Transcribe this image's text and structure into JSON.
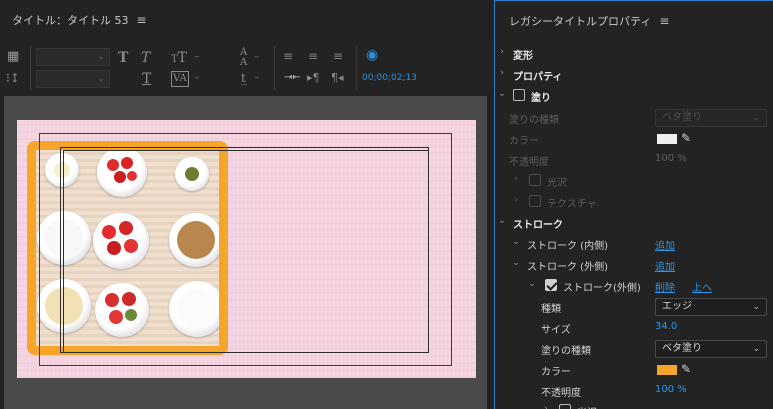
{
  "title_panel": {
    "title": "タイトル：タイトル 53",
    "menu_icon": "hamburger-menu-icon",
    "timecode": "00;00;02;13"
  },
  "props_panel": {
    "title": "レガシータイトルプロパティ",
    "menu_icon": "hamburger-menu-icon",
    "sections": {
      "transform": "変形",
      "properties": "プロパティ",
      "fill": "塗り",
      "fill_type_label": "塗りの種類",
      "fill_type_value": "ベタ塗り",
      "color_label": "カラー",
      "opacity_label": "不透明度",
      "opacity_value": "100 %",
      "sheen": "光沢",
      "texture": "テクスチャ",
      "strokes": "ストローク",
      "inner_strokes": "ストローク (内側)",
      "inner_add": "追加",
      "outer_strokes": "ストローク (外側)",
      "outer_add": "追加",
      "outer_stroke_item": "ストローク(外側)",
      "delete": "削除",
      "move_up": "上へ",
      "type_label": "種類",
      "type_value": "エッジ",
      "size_label": "サイズ",
      "size_value": "34.0",
      "stroke_fill_type_label": "塗りの種類",
      "stroke_fill_type_value": "ベタ塗り",
      "stroke_color_label": "カラー",
      "stroke_opacity_label": "不透明度",
      "stroke_opacity_value": "100 %",
      "sheen2": "光沢"
    },
    "colors": {
      "fill_color": "#eeeeee",
      "stroke_color": "#f4a52a",
      "accent": "#2f95e6"
    }
  }
}
